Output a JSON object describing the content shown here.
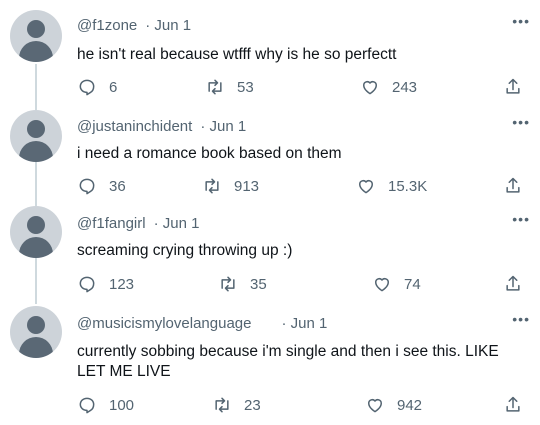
{
  "tweets": [
    {
      "handle": "@f1zone",
      "date": "· Jun 1",
      "text": "he isn't real because wtfff why is he so perfectt",
      "replies": "6",
      "retweets": "53",
      "likes": "243"
    },
    {
      "handle": "@justaninchident",
      "date": "· Jun 1",
      "text": "i need a romance book based on them",
      "replies": "36",
      "retweets": "913",
      "likes": "15.3K"
    },
    {
      "handle": "@f1fangirl",
      "date": "· Jun 1",
      "text": "screaming crying throwing up :)",
      "replies": "123",
      "retweets": "35",
      "likes": "74"
    },
    {
      "handle": "@musicismylovelanguage",
      "date": "· Jun 1",
      "text": "currently sobbing because i'm single and then i see this. LIKE LET ME LIVE",
      "replies": "100",
      "retweets": "23",
      "likes": "942"
    }
  ],
  "more_glyph": "•••",
  "icons": {
    "reply": "reply-icon",
    "retweet": "retweet-icon",
    "like": "heart-icon",
    "share": "share-icon",
    "more": "more-icon",
    "avatar": "default-avatar-icon"
  },
  "colors": {
    "text": "#0f1419",
    "secondary": "#536471",
    "avatar_bg": "#cdd3d9",
    "avatar_fg": "#5a6875",
    "thread_line": "#cfd9de"
  }
}
